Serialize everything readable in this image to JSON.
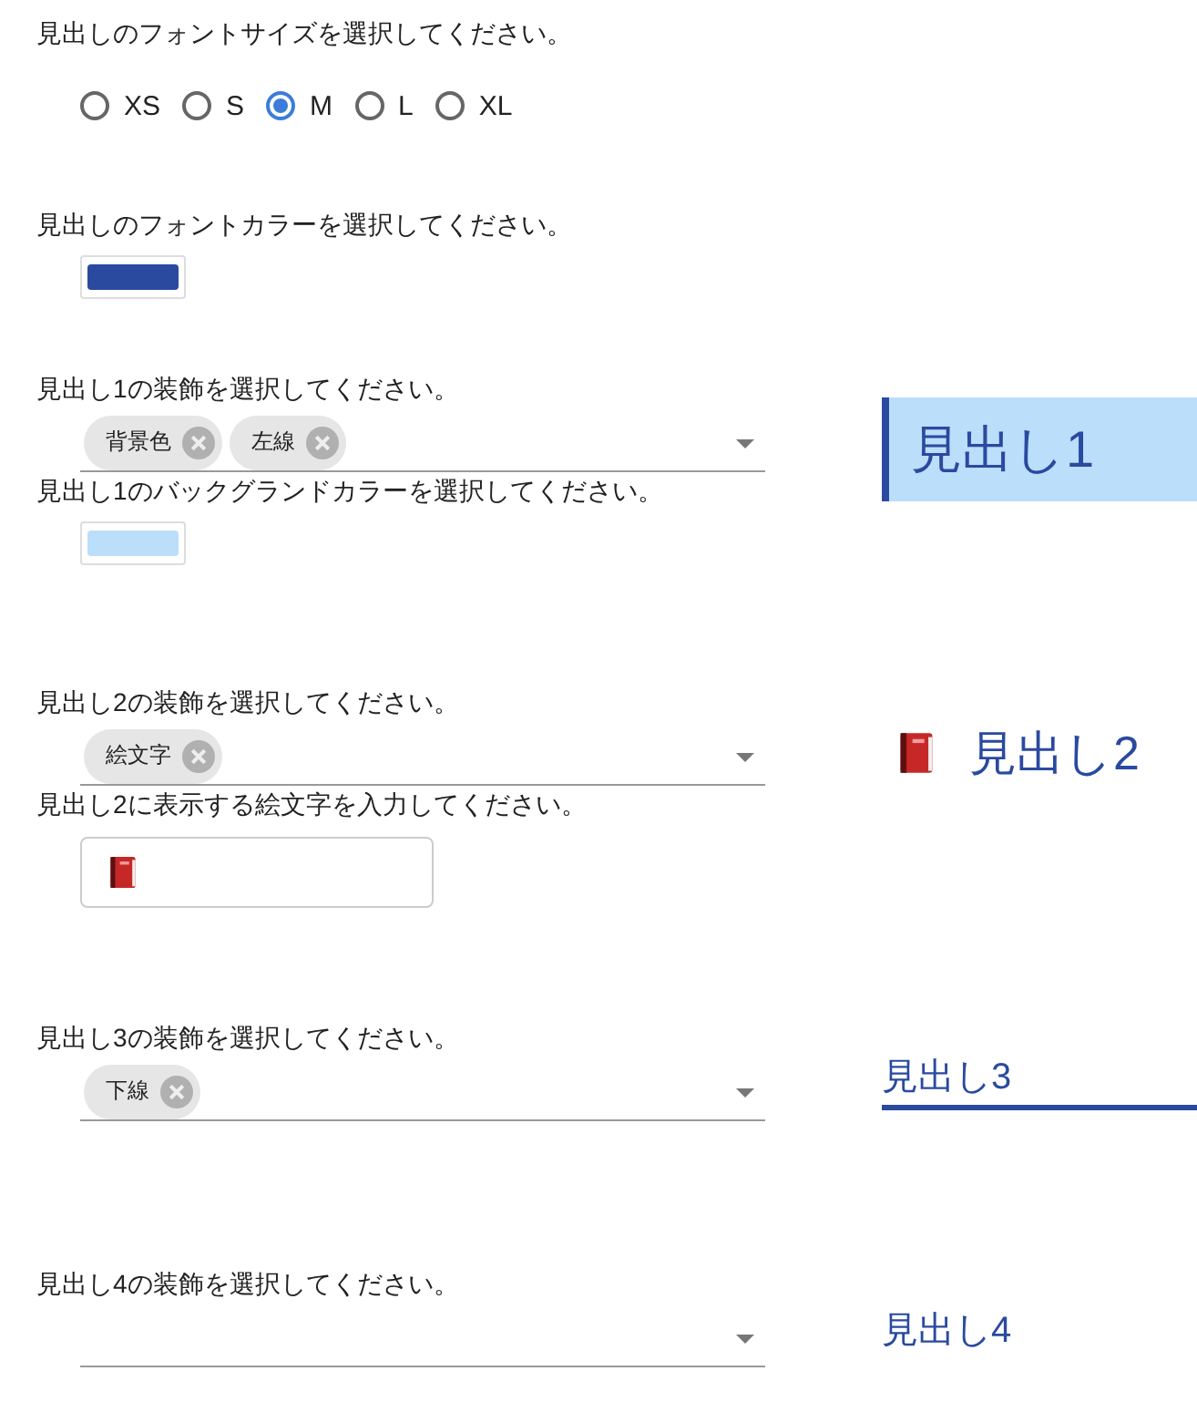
{
  "font_size": {
    "label": "見出しのフォントサイズを選択してください。",
    "options": [
      {
        "label": "XS",
        "selected": false
      },
      {
        "label": "S",
        "selected": false
      },
      {
        "label": "M",
        "selected": true
      },
      {
        "label": "L",
        "selected": false
      },
      {
        "label": "XL",
        "selected": false
      }
    ]
  },
  "font_color": {
    "label": "見出しのフォントカラーを選択してください。",
    "color": "#2a4aa0"
  },
  "headings": [
    {
      "label": "見出し1の装飾を選択してください。",
      "chips": [
        {
          "label": "背景色",
          "kind": "background"
        },
        {
          "label": "左線",
          "kind": "leftline"
        }
      ],
      "extra": {
        "kind": "color",
        "label": "見出し1のバックグランドカラーを選択してください。",
        "color": "#bbdefb"
      },
      "preview": "見出し1",
      "kind": "large"
    },
    {
      "label": "見出し2の装飾を選択してください。",
      "chips": [
        {
          "label": "絵文字",
          "kind": "emoji"
        }
      ],
      "extra": {
        "kind": "emoji",
        "label": "見出し2に表示する絵文字を入力してください。"
      },
      "preview": "見出し2",
      "kind": "medium"
    },
    {
      "label": "見出し3の装飾を選択してください。",
      "chips": [
        {
          "label": "下線",
          "kind": "underline"
        }
      ],
      "preview": "見出し3",
      "kind": "small"
    },
    {
      "label": "見出し4の装飾を選択してください。",
      "preview": "見出し4",
      "kind": "small"
    }
  ]
}
